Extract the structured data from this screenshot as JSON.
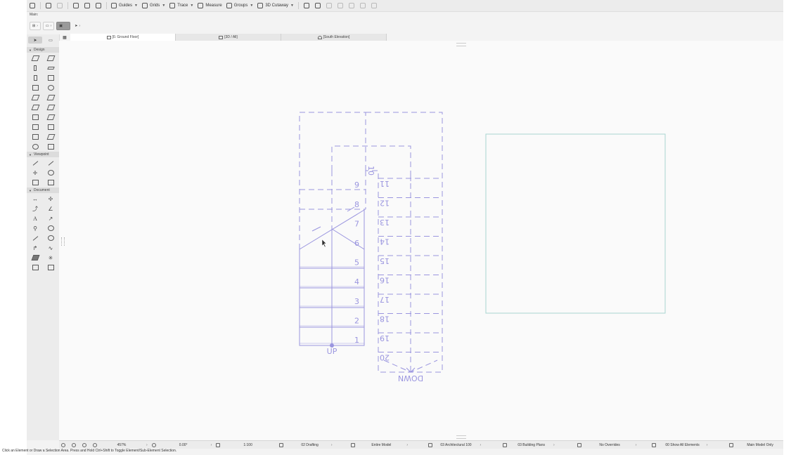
{
  "toolbar": {
    "guides": "Guides",
    "grids": "Grids",
    "trace": "Trace",
    "measure": "Measure",
    "groups": "Groups",
    "cutaway": "3D Cutaway"
  },
  "main_label": "Main:",
  "tabs": [
    {
      "label": "[0. Ground Floor]",
      "active": true
    },
    {
      "label": "[3D / All]",
      "active": false
    },
    {
      "label": "[South Elevation]",
      "active": false
    }
  ],
  "toolbox": {
    "sections": [
      "Design",
      "Viewpoint",
      "Document"
    ]
  },
  "drawing": {
    "stair_up_label": "UP",
    "stair_down_label": "DOWN",
    "up_steps": [
      "1",
      "2",
      "3",
      "4",
      "5",
      "6",
      "7",
      "8",
      "9",
      "10"
    ],
    "down_steps": [
      "11",
      "12",
      "13",
      "14",
      "15",
      "16",
      "17",
      "18",
      "19",
      "20"
    ],
    "stair_color": "#9a95df",
    "box_color": "#a8d4d0"
  },
  "status": {
    "zoom": "457%",
    "angle": "0.00°",
    "scale": "1:100",
    "pen_set": "02 Drafting",
    "model_view": "Entire Model",
    "layer_combo": "03 Architectural 100",
    "view_set": "03 Building Plans",
    "overrides": "No Overrides",
    "show_elements": "00 Show All Elements",
    "model_only": "Main Model Only",
    "hint": "Click an Element or Draw a Selection Area. Press and Hold Ctrl+Shift to Toggle Element/Sub-Element Selection."
  }
}
